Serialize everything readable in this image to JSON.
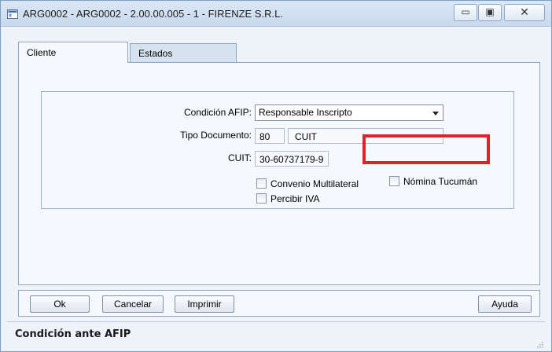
{
  "window": {
    "title": "ARG0002 - ARG0002 - 2.00.00.005 - 1 - FIRENZE S.R.L.",
    "controls": {
      "minimize": "▭",
      "maximize": "▣",
      "close": "✕"
    }
  },
  "tabs": [
    {
      "label": "Cliente",
      "selected": true
    },
    {
      "label": "Estados",
      "selected": false
    }
  ],
  "form": {
    "condicion_label": "Condición AFIP:",
    "condicion_value": "Responsable Inscripto",
    "tipo_doc_label": "Tipo Documento:",
    "tipo_doc_code": "80",
    "tipo_doc_name": "CUIT",
    "cuit_label": "CUIT:",
    "cuit_value": "30-60737179-9",
    "checkboxes": {
      "convenio": {
        "label": "Convenio Multilateral",
        "checked": false
      },
      "percibir": {
        "label": "Percibir IVA",
        "checked": false
      },
      "nomina": {
        "label": "Nómina Tucumán",
        "checked": false
      }
    }
  },
  "buttons": {
    "ok": "Ok",
    "cancelar": "Cancelar",
    "imprimir": "Imprimir",
    "ayuda": "Ayuda"
  },
  "status": {
    "text": "Condición ante AFIP"
  },
  "colors": {
    "highlight": "#e0202a",
    "frame": "#8fa5bd"
  }
}
